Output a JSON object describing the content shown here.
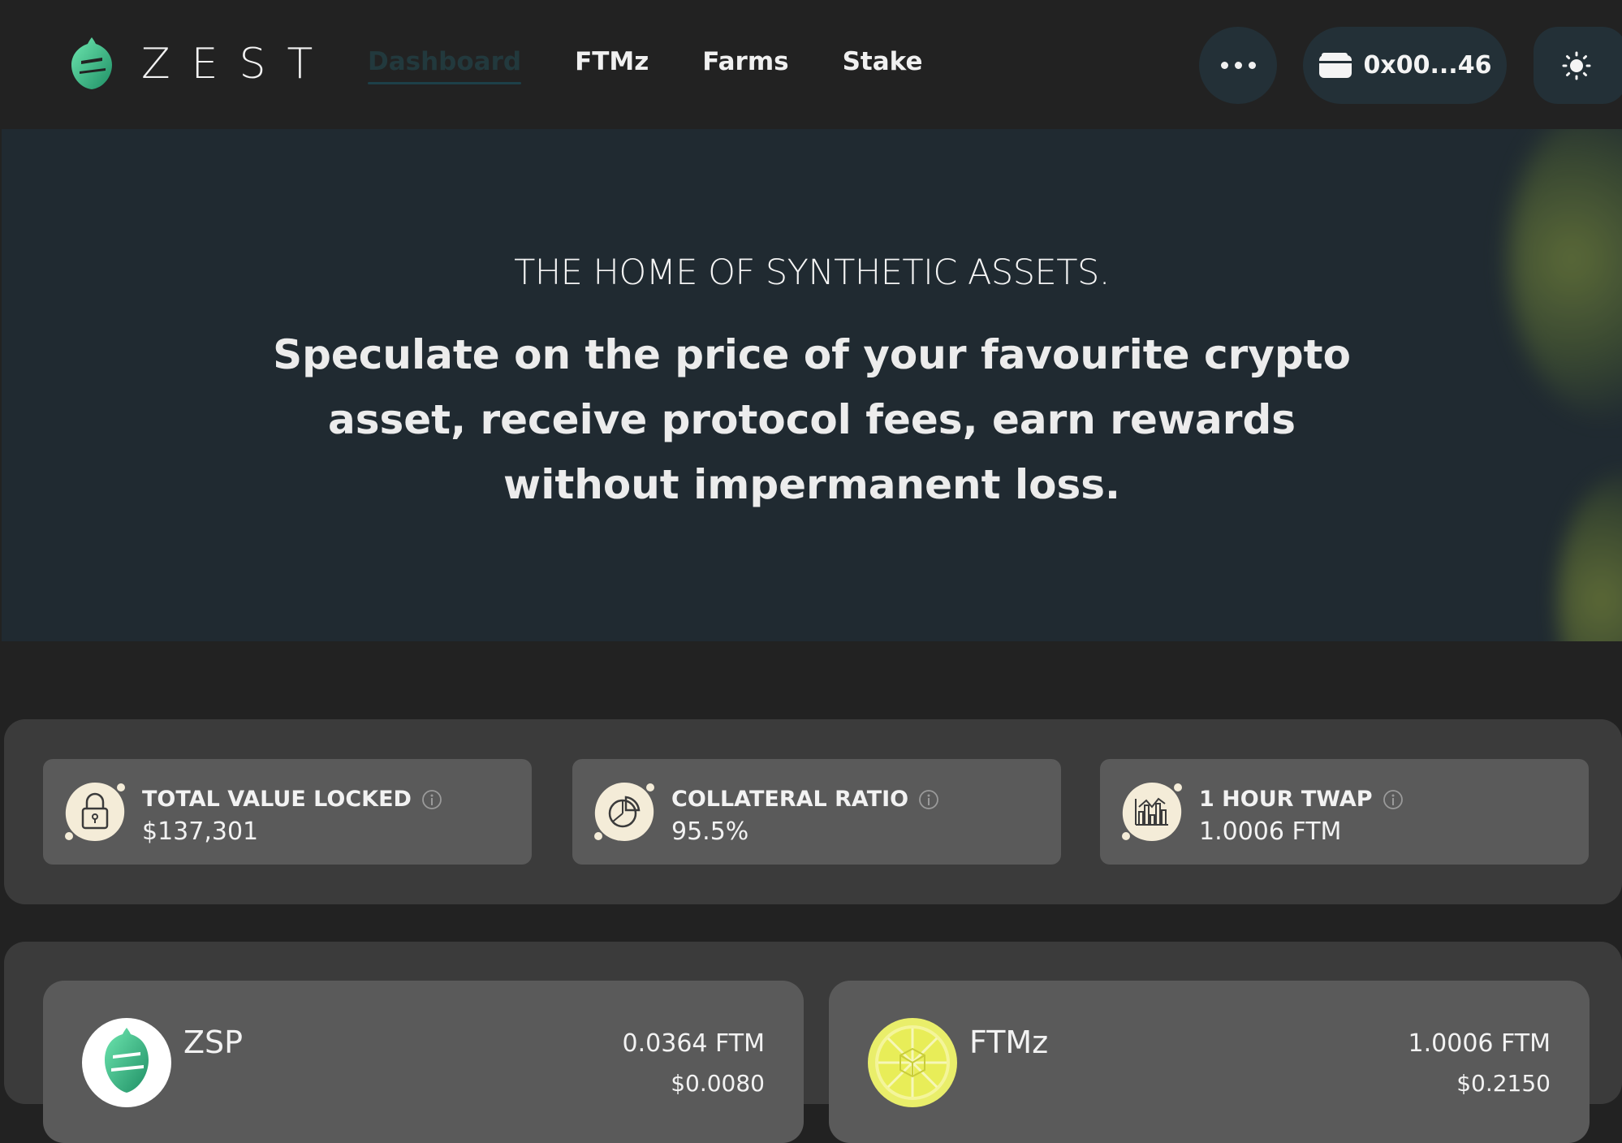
{
  "brand": {
    "logo_text": "ZEST"
  },
  "nav": {
    "items": [
      {
        "label": "Dashboard",
        "active": true
      },
      {
        "label": "FTMz",
        "active": false
      },
      {
        "label": "Farms",
        "active": false
      },
      {
        "label": "Stake",
        "active": false
      }
    ]
  },
  "header": {
    "more_icon": "more-dots-icon",
    "wallet_icon": "wallet-icon",
    "wallet_address": "0x00...46",
    "theme_icon": "sun-icon"
  },
  "hero": {
    "kicker": "THE HOME OF SYNTHETIC ASSETS.",
    "headline": "Speculate on the price of your favourite crypto asset, receive protocol fees, earn rewards without impermanent loss."
  },
  "stats": [
    {
      "label": "TOTAL VALUE LOCKED",
      "value": "$137,301",
      "icon": "lock-icon"
    },
    {
      "label": "COLLATERAL RATIO",
      "value": "95.5%",
      "icon": "pie-chart-icon"
    },
    {
      "label": "1 HOUR TWAP",
      "value": "1.0006 FTM",
      "icon": "bar-chart-icon"
    }
  ],
  "tokens": [
    {
      "name": "ZSP",
      "price": "0.0364 FTM",
      "usd": "$0.0080",
      "icon": "zest-logo-icon"
    },
    {
      "name": "FTMz",
      "price": "1.0006 FTM",
      "usd": "$0.2150",
      "icon": "lemon-slice-icon"
    }
  ],
  "colors": {
    "background": "#222222",
    "hero_background": "#202a31",
    "panel": "#3b3b3b",
    "card": "#5a5a5a",
    "button": "#233037",
    "accent_green": "#3fb58a",
    "icon_cream": "#f4ecd8"
  }
}
